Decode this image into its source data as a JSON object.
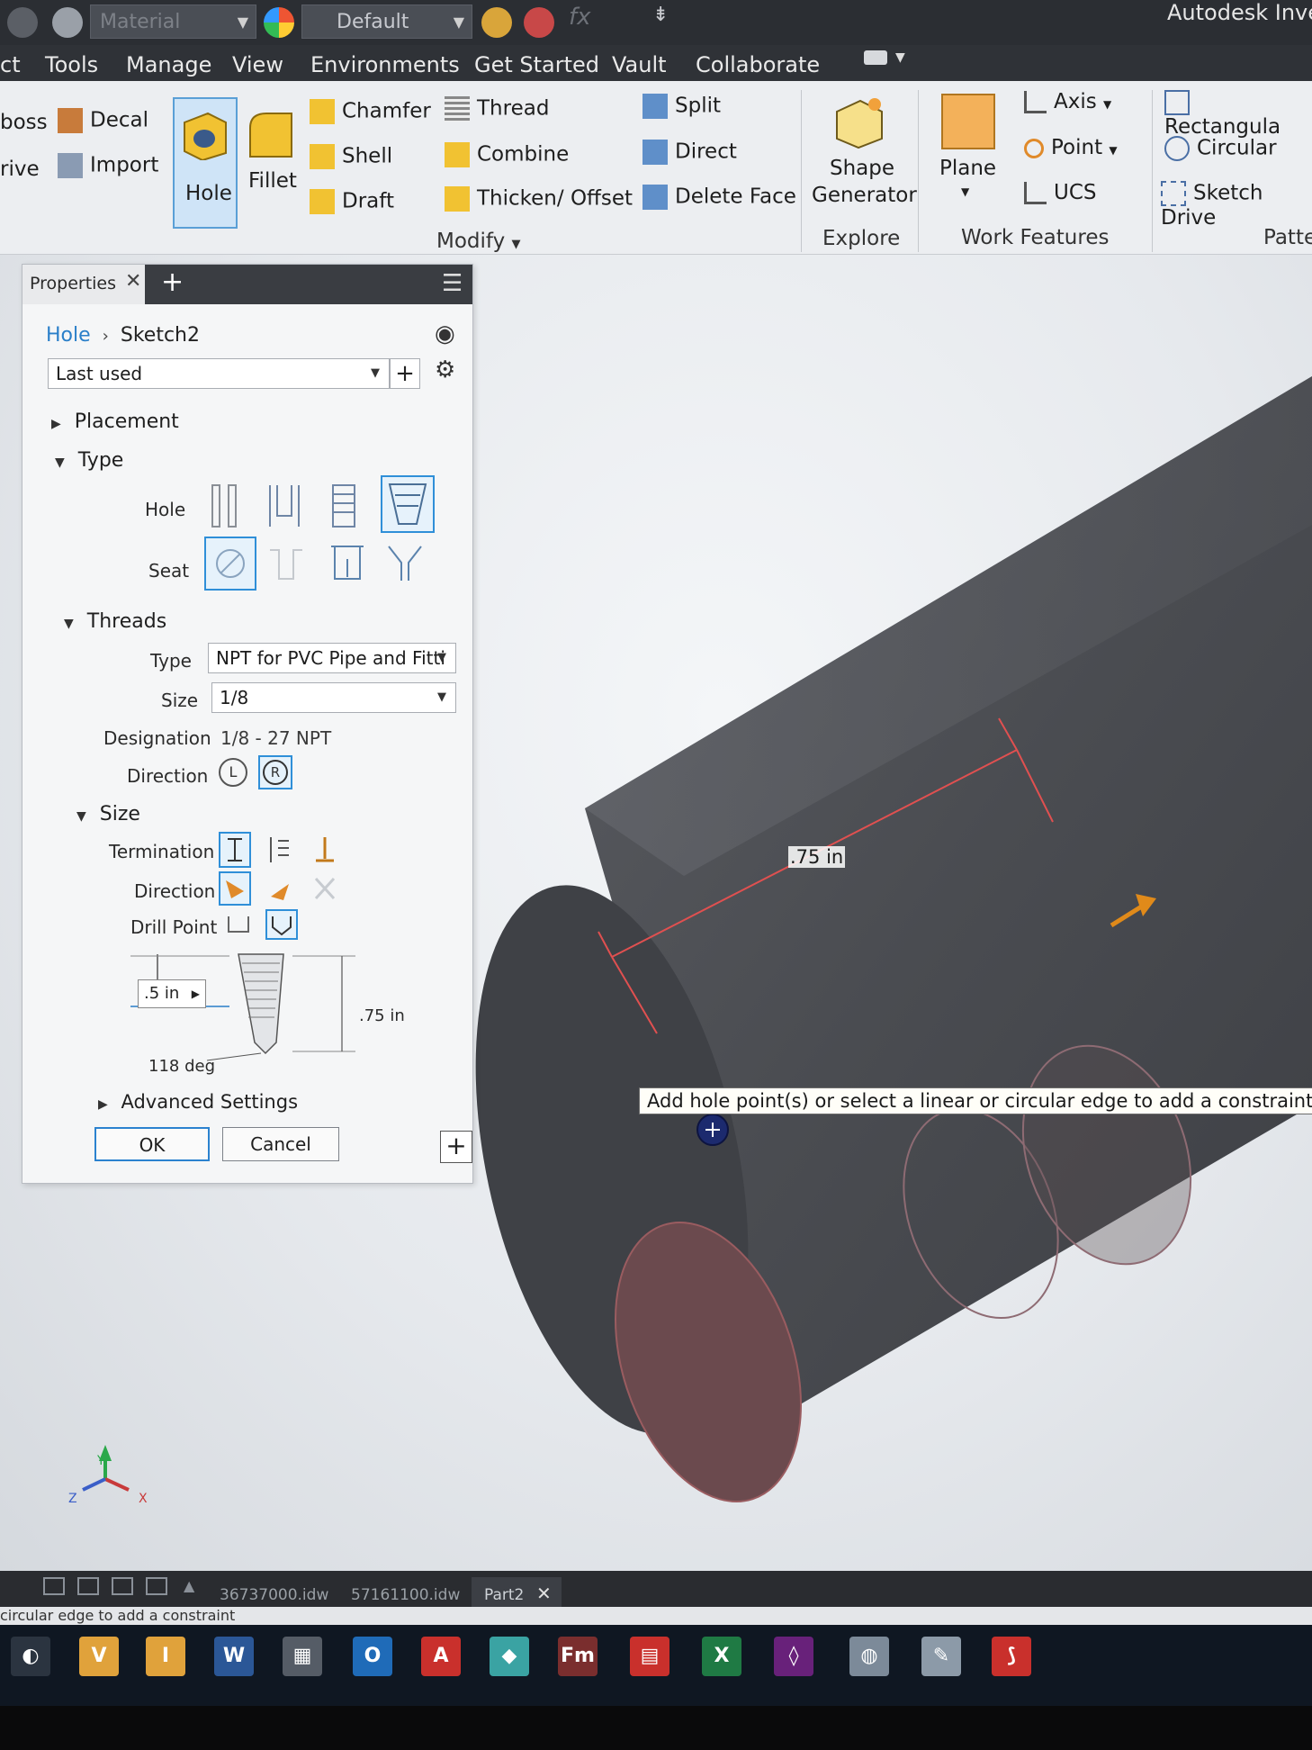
{
  "window": {
    "app_title": "Autodesk Inve",
    "material_field": "Material",
    "appearance_field": "Default"
  },
  "menu": {
    "tabs": [
      "ct",
      "Tools",
      "Manage",
      "View",
      "Environments",
      "Get Started",
      "Vault",
      "Collaborate"
    ]
  },
  "ribbon": {
    "create": {
      "emboss": "boss",
      "derive": "rive",
      "decal": "Decal",
      "import": "Import"
    },
    "modify": {
      "hole": "Hole",
      "fillet": "Fillet",
      "chamfer": "Chamfer",
      "shell": "Shell",
      "draft": "Draft",
      "thread": "Thread",
      "combine": "Combine",
      "thicken_offset": "Thicken/ Offset",
      "split": "Split",
      "direct": "Direct",
      "delete_face": "Delete Face",
      "group_label": "Modify"
    },
    "explore": {
      "shape_generator_line1": "Shape",
      "shape_generator_line2": "Generator",
      "group_label": "Explore"
    },
    "work_features": {
      "plane": "Plane",
      "axis": "Axis",
      "point": "Point",
      "ucs": "UCS",
      "group_label": "Work Features"
    },
    "pattern": {
      "rectangular": "Rectangula",
      "circular": "Circular",
      "sketch_driven": "Sketch Drive",
      "group_label": "Patte"
    }
  },
  "properties": {
    "tab_label": "Properties",
    "breadcrumb_root": "Hole",
    "breadcrumb_current": "Sketch2",
    "preset": "Last used",
    "placement_label": "Placement",
    "type_label": "Type",
    "hole_label": "Hole",
    "seat_label": "Seat",
    "threads_label": "Threads",
    "thread_type_label": "Type",
    "thread_type_value": "NPT for PVC Pipe and Fitti",
    "thread_size_label": "Size",
    "thread_size_value": "1/8",
    "designation_label": "Designation",
    "designation_value": "1/8 - 27 NPT",
    "direction_label": "Direction",
    "size_label": "Size",
    "termination_label": "Termination",
    "size_direction_label": "Direction",
    "drill_point_label": "Drill Point",
    "diameter_value": ".5 in",
    "depth_value": ".75 in",
    "angle_value": "118 deg",
    "advanced_label": "Advanced Settings",
    "ok_label": "OK",
    "cancel_label": "Cancel"
  },
  "viewport": {
    "dimension_label": ".75 in",
    "tooltip": "Add hole point(s) or select a linear or circular edge to add a constraint",
    "triad": {
      "y": "Y",
      "z": "Z",
      "x": "X"
    }
  },
  "document_tabs": [
    "36737000.idw",
    "57161100.idw",
    "Part2"
  ],
  "status_text": "circular edge to add a constraint",
  "colors": {
    "accent": "#2f8fd8",
    "title_bar": "#2b2e33",
    "ribbon_bg": "#eceef1",
    "model_gray": "#4b4d52",
    "sketch_red": "#e05050"
  }
}
